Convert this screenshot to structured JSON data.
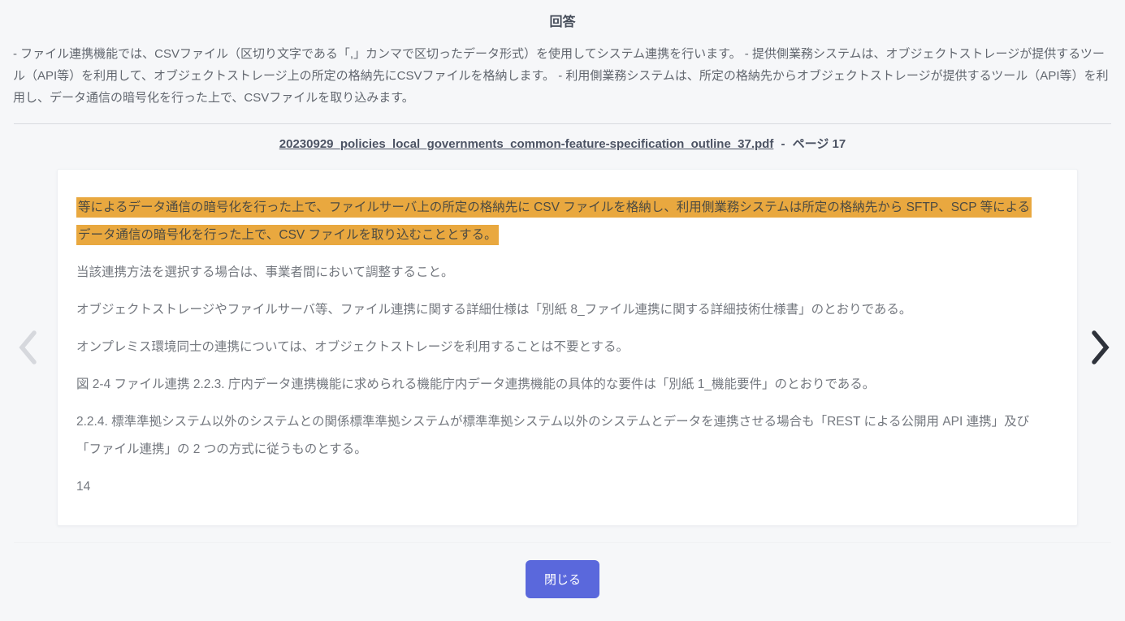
{
  "modal": {
    "title": "回答",
    "answer_text": "- ファイル連携機能では、CSVファイル（区切り文字である「,」カンマで区切ったデータ形式）を使用してシステム連携を行います。 - 提供側業務システムは、オブジェクトストレージが提供するツール（API等）を利用して、オブジェクトストレージ上の所定の格納先にCSVファイルを格納します。 - 利用側業務システムは、所定の格納先からオブジェクトストレージが提供するツール（API等）を利用し、データ通信の暗号化を行った上で、CSVファイルを取り込みます。",
    "source": {
      "file_name": "20230929_policies_local_governments_common-feature-specification_outline_37.pdf",
      "separator": "-",
      "page_label": "ページ 17"
    },
    "close_label": "閉じる"
  },
  "document": {
    "highlight": "等によるデータ通信の暗号化を行った上で、ファイルサーバ上の所定の格納先に CSV ファイルを格納し、利用側業務システムは所定の格納先から SFTP、SCP 等によるデータ通信の暗号化を行った上で、CSV ファイルを取り込むこととする。",
    "paragraphs": [
      "当該連携方法を選択する場合は、事業者間において調整すること。",
      "オブジェクトストレージやファイルサーバ等、ファイル連携に関する詳細仕様は「別紙 8_ファイル連携に関する詳細技術仕様書」のとおりである。",
      "オンプレミス環境同士の連携については、オブジェクトストレージを利用することは不要とする。",
      "図 2-4 ファイル連携 2.2.3. 庁内データ連携機能に求められる機能庁内データ連携機能の具体的な要件は「別紙 1_機能要件」のとおりである。",
      "2.2.4. 標準準拠システム以外のシステムとの関係標準準拠システムが標準準拠システム以外のシステムとデータを連携させる場合も「REST による公開用 API 連携」及び「ファイル連携」の 2 つの方式に従うものとする。"
    ],
    "page_number": "14"
  },
  "nav": {
    "prev_icon": "chevron-left",
    "next_icon": "chevron-right"
  },
  "colors": {
    "background": "#F6F7F9",
    "card": "#FFFFFF",
    "highlight": "#E9A83F",
    "primary_button": "#5A68DC",
    "prev_chevron": "#D6D8DD",
    "next_chevron": "#2E323B"
  }
}
